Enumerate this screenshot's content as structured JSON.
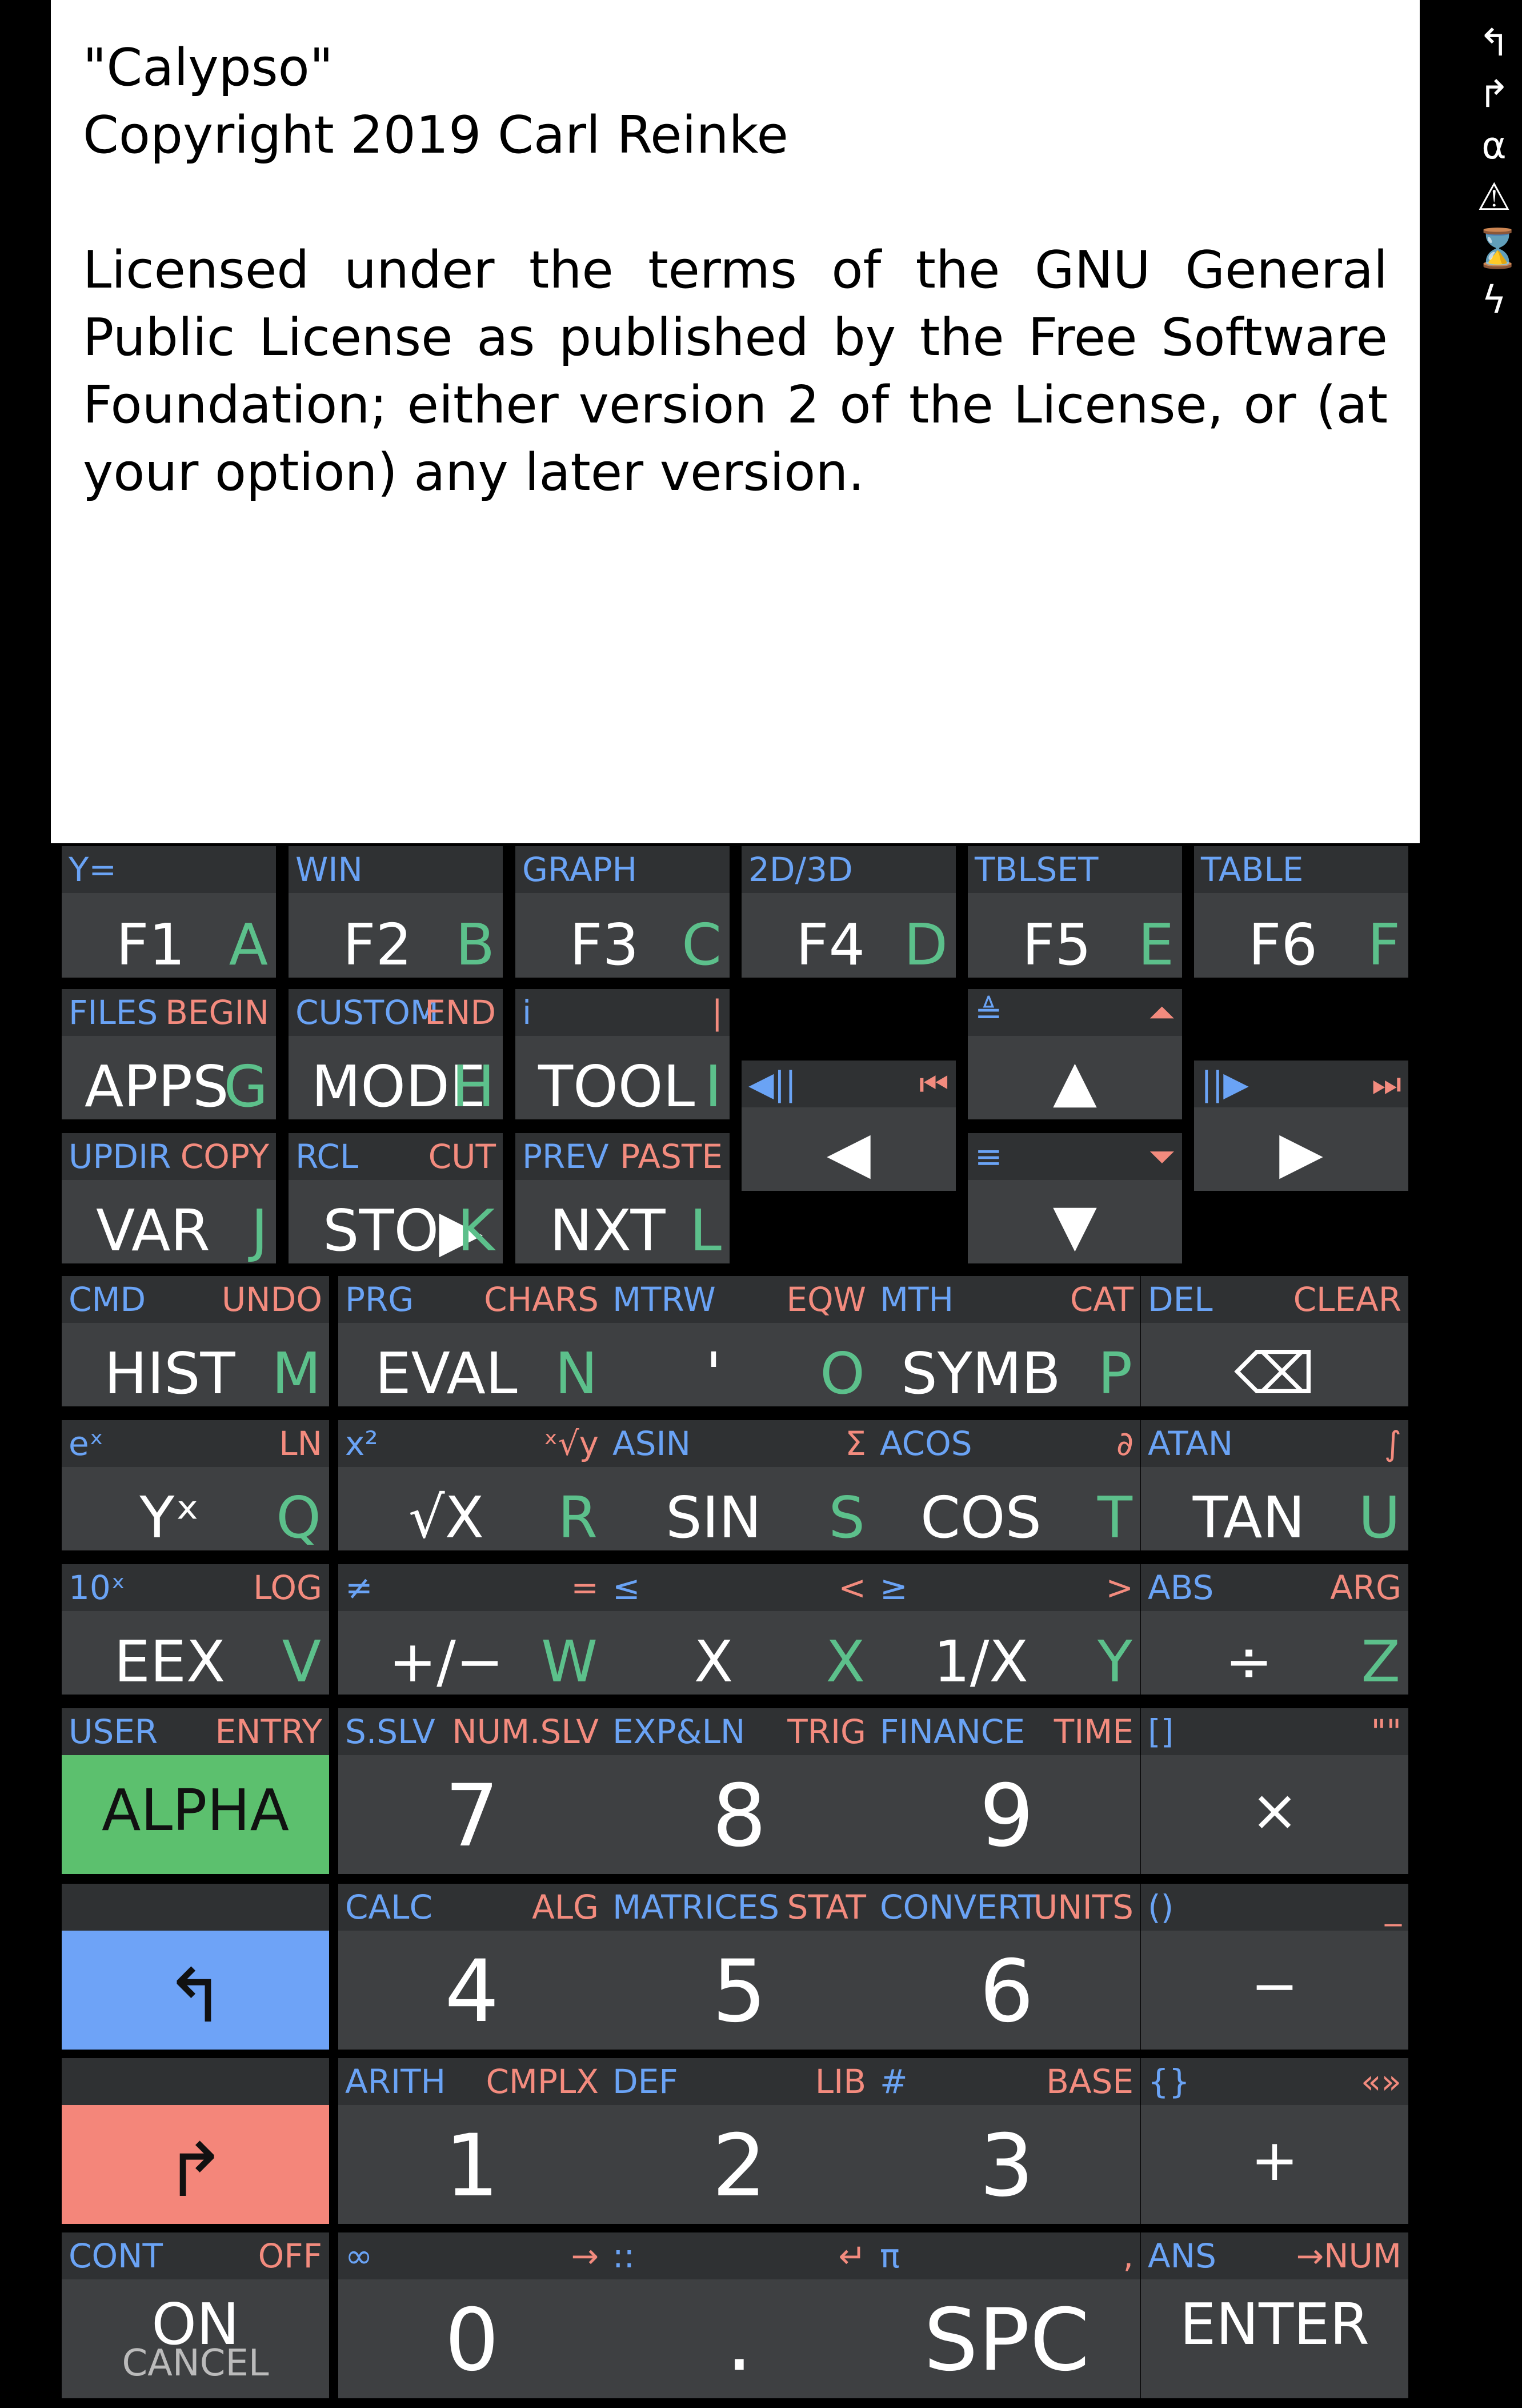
{
  "screen": {
    "title": "\"Calypso\"",
    "copyright": "Copyright 2019 Carl Reinke",
    "license": "Licensed under the terms of the GNU General Public License as published by the Free Software Foundation; either version 2 of the License, or (at your option) any later version."
  },
  "annunciators": [
    "↰",
    "↱",
    "α",
    "⚠",
    "⌛",
    "ϟ"
  ],
  "row_f": [
    {
      "l": "Y=",
      "main": "F1",
      "alpha": "A"
    },
    {
      "l": "WIN",
      "main": "F2",
      "alpha": "B"
    },
    {
      "l": "GRAPH",
      "main": "F3",
      "alpha": "C"
    },
    {
      "l": "2D/3D",
      "main": "F4",
      "alpha": "D"
    },
    {
      "l": "TBLSET",
      "main": "F5",
      "alpha": "E"
    },
    {
      "l": "TABLE",
      "main": "F6",
      "alpha": "F"
    }
  ],
  "row2": [
    {
      "l": "FILES",
      "r": "BEGIN",
      "main": "APPS",
      "alpha": "G"
    },
    {
      "l": "CUSTOM",
      "r": "END",
      "main": "MODE",
      "alpha": "H"
    },
    {
      "l": "i",
      "r": "|",
      "main": "TOOL",
      "alpha": "I"
    }
  ],
  "row3": [
    {
      "l": "UPDIR",
      "r": "COPY",
      "main": "VAR",
      "alpha": "J"
    },
    {
      "l": "RCL",
      "r": "CUT",
      "main": "STO▶",
      "alpha": "K"
    },
    {
      "l": "PREV",
      "r": "PASTE",
      "main": "NXT",
      "alpha": "L"
    }
  ],
  "nav": {
    "up": {
      "l": "≜",
      "r": "⏶",
      "main": "▲"
    },
    "left": {
      "l": "◀||",
      "r": "⏮",
      "main": "◀"
    },
    "right": {
      "l": "||▶",
      "r": "⏭",
      "main": "▶"
    },
    "down": {
      "l": "≡",
      "r": "⏷",
      "main": "▼"
    }
  },
  "rows5": [
    [
      {
        "l": "CMD",
        "r": "UNDO",
        "main": "HIST",
        "alpha": "M"
      },
      {
        "l": "PRG",
        "r": "CHARS",
        "main": "EVAL",
        "alpha": "N"
      },
      {
        "l": "MTRW",
        "r": "EQW",
        "main": "'",
        "alpha": "O"
      },
      {
        "l": "MTH",
        "r": "CAT",
        "main": "SYMB",
        "alpha": "P"
      },
      {
        "l": "DEL",
        "r": "CLEAR",
        "main": "⌫",
        "alpha": ""
      }
    ],
    [
      {
        "l": "eˣ",
        "r": "LN",
        "main": "Yˣ",
        "alpha": "Q"
      },
      {
        "l": "x²",
        "r": "ˣ√y",
        "main": "√X",
        "alpha": "R"
      },
      {
        "l": "ASIN",
        "r": "Σ",
        "main": "SIN",
        "alpha": "S"
      },
      {
        "l": "ACOS",
        "r": "∂",
        "main": "COS",
        "alpha": "T"
      },
      {
        "l": "ATAN",
        "r": "∫",
        "main": "TAN",
        "alpha": "U"
      }
    ],
    [
      {
        "l": "10ˣ",
        "r": "LOG",
        "main": "EEX",
        "alpha": "V"
      },
      {
        "l": "≠",
        "r": "=",
        "main": "+/−",
        "alpha": "W"
      },
      {
        "l": "≤",
        "r": "<",
        "main": "X",
        "alpha": "X"
      },
      {
        "l": "≥",
        "r": ">",
        "main": "1/X",
        "alpha": "Y"
      },
      {
        "l": "ABS",
        "r": "ARG",
        "main": "÷",
        "alpha": "Z"
      }
    ],
    [
      {
        "l": "USER",
        "r": "ENTRY",
        "main": "ALPHA",
        "alpha": ""
      },
      {
        "l": "S.SLV",
        "r": "NUM.SLV",
        "main": "7",
        "alpha": ""
      },
      {
        "l": "EXP&LN",
        "r": "TRIG",
        "main": "8",
        "alpha": ""
      },
      {
        "l": "FINANCE",
        "r": "TIME",
        "main": "9",
        "alpha": ""
      },
      {
        "l": "[]",
        "r": "\"\"",
        "main": "×",
        "alpha": ""
      }
    ],
    [
      {
        "l": "",
        "r": "",
        "main": "↰",
        "alpha": ""
      },
      {
        "l": "CALC",
        "r": "ALG",
        "main": "4",
        "alpha": ""
      },
      {
        "l": "MATRICES",
        "r": "STAT",
        "main": "5",
        "alpha": ""
      },
      {
        "l": "CONVERT",
        "r": "UNITS",
        "main": "6",
        "alpha": ""
      },
      {
        "l": "()",
        "r": "_",
        "main": "−",
        "alpha": ""
      }
    ],
    [
      {
        "l": "",
        "r": "",
        "main": "↱",
        "alpha": ""
      },
      {
        "l": "ARITH",
        "r": "CMPLX",
        "main": "1",
        "alpha": ""
      },
      {
        "l": "DEF",
        "r": "LIB",
        "main": "2",
        "alpha": ""
      },
      {
        "l": "#",
        "r": "BASE",
        "main": "3",
        "alpha": ""
      },
      {
        "l": "{}",
        "r": "«»",
        "main": "+",
        "alpha": ""
      }
    ],
    [
      {
        "l": "CONT",
        "r": "OFF",
        "main": "ON",
        "alpha": "",
        "sub": "CANCEL"
      },
      {
        "l": "∞",
        "r": "→",
        "main": "0",
        "alpha": ""
      },
      {
        "l": "::",
        "r": "↵",
        "main": ".",
        "alpha": ""
      },
      {
        "l": "π",
        "r": ",",
        "main": "SPC",
        "alpha": ""
      },
      {
        "l": "ANS",
        "r": "→NUM",
        "main": "ENTER",
        "alpha": ""
      }
    ]
  ]
}
